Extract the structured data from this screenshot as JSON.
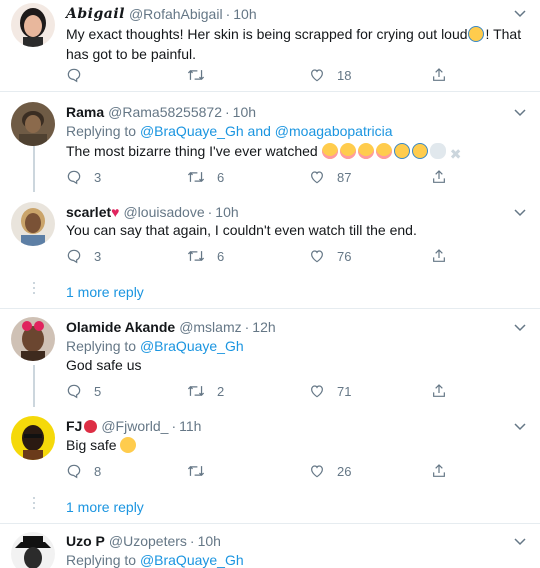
{
  "tweets": [
    {
      "name": "Abigail",
      "handle": "@RofahAbigail",
      "time": "10h",
      "text": "My exact thoughts! Her skin is being scrapped for crying out loud",
      "text_tail": "! That has got to be painful.",
      "reply": "",
      "retweet": "",
      "like": "18"
    },
    {
      "name": "Rama",
      "handle": "@Rama58255872",
      "time": "10h",
      "replying_prefix": "Replying to",
      "replying_a": "@BraQuaye_Gh",
      "replying_and": "and",
      "replying_b": "@moagabopatricia",
      "text": "The most bizarre thing I've ever watched",
      "reply": "3",
      "retweet": "6",
      "like": "87"
    },
    {
      "name": "scarlet",
      "handle": "@louisadove",
      "time": "10h",
      "text": "You can say that again, I couldn't even watch till the end.",
      "reply": "3",
      "retweet": "6",
      "like": "76"
    },
    {
      "name": "Olamide Akande",
      "handle": "@mslamz",
      "time": "12h",
      "replying_prefix": "Replying to",
      "replying_a": "@BraQuaye_Gh",
      "text": "God safe us",
      "reply": "5",
      "retweet": "2",
      "like": "71"
    },
    {
      "name": "FJ",
      "handle": "@Fjworld_",
      "time": "11h",
      "text": "Big safe",
      "reply": "8",
      "retweet": "",
      "like": "26"
    },
    {
      "name": "Uzo P",
      "handle": "@Uzopeters",
      "time": "10h",
      "replying_prefix": "Replying to",
      "replying_a": "@BraQuaye_Gh"
    }
  ],
  "more_replies_1": "1 more reply",
  "more_replies_2": "1 more reply",
  "separator_dot": "·",
  "colors": {
    "link": "#1b95e0",
    "muted": "#657786",
    "divider": "#e6ecf0",
    "thread": "#ccd6dd"
  },
  "icons": [
    "reply-icon",
    "retweet-icon",
    "like-icon",
    "share-icon",
    "caret-down-icon"
  ]
}
